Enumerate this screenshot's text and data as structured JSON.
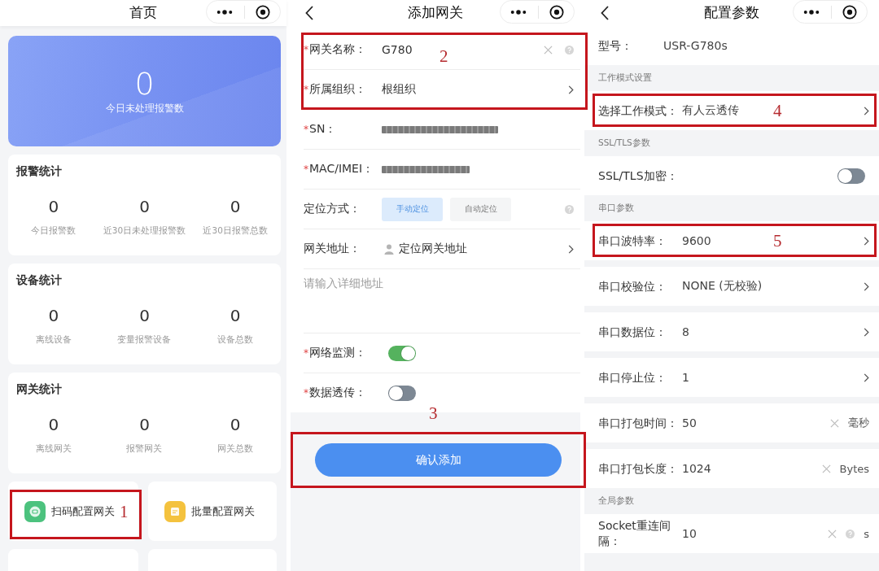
{
  "home": {
    "title": "首页",
    "summary": {
      "value": "0",
      "label": "今日未处理报警数"
    },
    "stat_cards": [
      {
        "title": "报警统计",
        "stats": [
          {
            "value": "0",
            "label": "今日报警数"
          },
          {
            "value": "0",
            "label": "近30日未处理报警数"
          },
          {
            "value": "0",
            "label": "近30日报警总数"
          }
        ]
      },
      {
        "title": "设备统计",
        "stats": [
          {
            "value": "0",
            "label": "离线设备"
          },
          {
            "value": "0",
            "label": "变量报警设备"
          },
          {
            "value": "0",
            "label": "设备总数"
          }
        ]
      },
      {
        "title": "网关统计",
        "stats": [
          {
            "value": "0",
            "label": "离线网关"
          },
          {
            "value": "0",
            "label": "报警网关"
          },
          {
            "value": "0",
            "label": "网关总数"
          }
        ]
      }
    ],
    "actions": [
      {
        "kind": "scan",
        "label": "扫码配置网关",
        "annotation": "1"
      },
      {
        "kind": "batch",
        "label": "批量配置网关"
      }
    ]
  },
  "add_gateway": {
    "back": true,
    "title": "添加网关",
    "groups": [
      {
        "annotation": "2",
        "rows": [
          {
            "kind": "input",
            "mark": "*",
            "label": "网关名称：",
            "value": "G780",
            "clear": true,
            "help": true
          },
          {
            "kind": "select",
            "mark": "*",
            "label": "所属组织：",
            "value": "根组织"
          }
        ]
      },
      {
        "rows": [
          {
            "kind": "redacted",
            "mark": "*",
            "label": "SN："
          },
          {
            "kind": "redacted",
            "mark": "*",
            "label": "MAC/IMEI："
          },
          {
            "kind": "segmented",
            "label": "定位方式：",
            "options": [
              {
                "label": "手动定位",
                "selected": true
              },
              {
                "label": "自动定位",
                "selected": false
              }
            ],
            "help": true
          },
          {
            "kind": "location",
            "label": "网关地址：",
            "value": "定位网关地址"
          },
          {
            "kind": "textarea",
            "placeholder": "请输入详细地址"
          },
          {
            "kind": "toggle",
            "mark": "*",
            "label": "网络监测：",
            "on": true
          },
          {
            "kind": "toggle",
            "mark": "*",
            "label": "数据透传：",
            "on": false
          }
        ]
      }
    ],
    "submit": {
      "label": "确认添加",
      "annotation": "3"
    }
  },
  "config": {
    "back": true,
    "title": "配置参数",
    "items": [
      {
        "kind": "info",
        "label": "型号：",
        "value": "USR-G780s"
      },
      {
        "kind": "header",
        "label": "工作模式设置"
      },
      {
        "kind": "select",
        "label": "选择工作模式：",
        "value": "有人云透传",
        "annotation": "4"
      },
      {
        "kind": "header",
        "label": "SSL/TLS参数"
      },
      {
        "kind": "toggle",
        "label": "SSL/TLS加密：",
        "on": false
      },
      {
        "kind": "header",
        "label": "串口参数"
      },
      {
        "kind": "select",
        "label": "串口波特率：",
        "value": "9600",
        "annotation": "5"
      },
      {
        "kind": "select",
        "label": "串口校验位：",
        "value": "NONE (无校验)"
      },
      {
        "kind": "select",
        "label": "串口数据位：",
        "value": "8"
      },
      {
        "kind": "select",
        "label": "串口停止位：",
        "value": "1"
      },
      {
        "kind": "input",
        "label": "串口打包时间：",
        "value": "50",
        "clear": true,
        "unit": "毫秒"
      },
      {
        "kind": "input",
        "label": "串口打包长度：",
        "value": "1024",
        "clear": true,
        "unit": "Bytes"
      },
      {
        "kind": "header",
        "label": "全局参数"
      },
      {
        "kind": "input",
        "label": "Socket重连间隔：",
        "value": "10",
        "clear": true,
        "help": true,
        "unit": "s"
      }
    ]
  }
}
